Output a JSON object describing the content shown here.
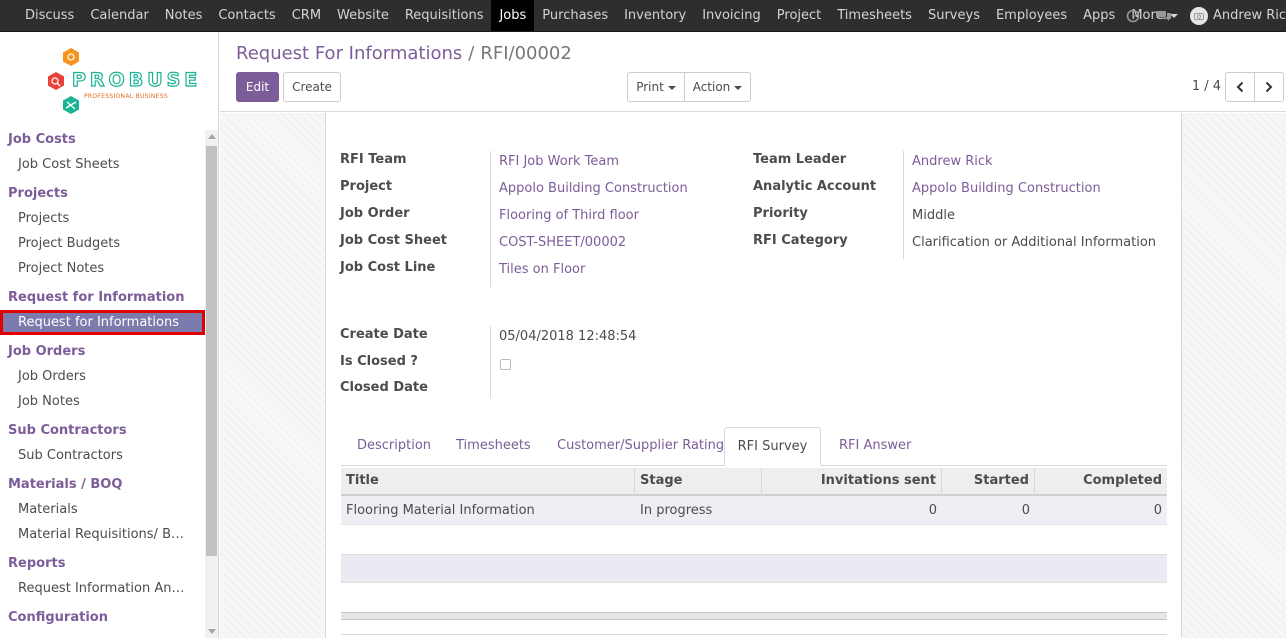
{
  "topbar": {
    "menu": [
      "Discuss",
      "Calendar",
      "Notes",
      "Contacts",
      "CRM",
      "Website",
      "Requisitions",
      "Jobs",
      "Purchases",
      "Inventory",
      "Invoicing",
      "Project",
      "Timesheets",
      "Surveys",
      "Employees",
      "Apps"
    ],
    "active": "Jobs",
    "more_label": "More",
    "user_name": "Andrew Ric"
  },
  "logo": {
    "brand": "PROBUSE",
    "tagline": "PROFESSIONAL BUSINESS"
  },
  "sidebar": {
    "sections": [
      {
        "title": "Job Costs",
        "items": [
          "Job Cost Sheets"
        ]
      },
      {
        "title": "Projects",
        "items": [
          "Projects",
          "Project Budgets",
          "Project Notes"
        ]
      },
      {
        "title": "Request for Information",
        "items": [
          "Request for Informations"
        ]
      },
      {
        "title": "Job Orders",
        "items": [
          "Job Orders",
          "Job Notes"
        ]
      },
      {
        "title": "Sub Contractors",
        "items": [
          "Sub Contractors"
        ]
      },
      {
        "title": "Materials / BOQ",
        "items": [
          "Materials",
          "Material Requisitions/ B…"
        ]
      },
      {
        "title": "Reports",
        "items": [
          "Request Information An…"
        ]
      },
      {
        "title": "Configuration",
        "items": []
      }
    ],
    "active_item": "Request for Informations"
  },
  "control": {
    "breadcrumb_parent": "Request For Informations",
    "breadcrumb_sep": "/",
    "breadcrumb_current": "RFI/00002",
    "edit_label": "Edit",
    "create_label": "Create",
    "print_label": "Print",
    "action_label": "Action",
    "pager": "1 / 4"
  },
  "form": {
    "left": [
      {
        "label": "RFI Team",
        "value": "RFI Job Work Team",
        "link": true
      },
      {
        "label": "Project",
        "value": "Appolo Building Construction",
        "link": true
      },
      {
        "label": "Job Order",
        "value": "Flooring of Third floor",
        "link": true
      },
      {
        "label": "Job Cost Sheet",
        "value": "COST-SHEET/00002",
        "link": true
      },
      {
        "label": "Job Cost Line",
        "value": "Tiles on Floor",
        "link": true
      }
    ],
    "right": [
      {
        "label": "Team Leader",
        "value": "Andrew Rick",
        "link": true
      },
      {
        "label": "Analytic Account",
        "value": "Appolo Building Construction",
        "link": true
      },
      {
        "label": "Priority",
        "value": "Middle",
        "link": false
      },
      {
        "label": "RFI Category",
        "value": "Clarification or Additional Information",
        "link": false
      }
    ],
    "dates": [
      {
        "label": "Create Date",
        "value": "05/04/2018 12:48:54"
      },
      {
        "label": "Is Closed ?",
        "value": ""
      },
      {
        "label": "Closed Date",
        "value": ""
      }
    ],
    "is_closed": false
  },
  "tabs": [
    "Description",
    "Timesheets",
    "Customer/Supplier Rating",
    "RFI Survey",
    "RFI Answer"
  ],
  "active_tab": "RFI Survey",
  "survey_table": {
    "columns": [
      "Title",
      "Stage",
      "Invitations sent",
      "Started",
      "Completed"
    ],
    "rows": [
      [
        "Flooring Material Information",
        "In progress",
        "0",
        "0",
        "0"
      ]
    ]
  },
  "colors": {
    "primary": "#7c5d99",
    "topbar": "#2e2e2e",
    "highlight": "#e00000"
  }
}
